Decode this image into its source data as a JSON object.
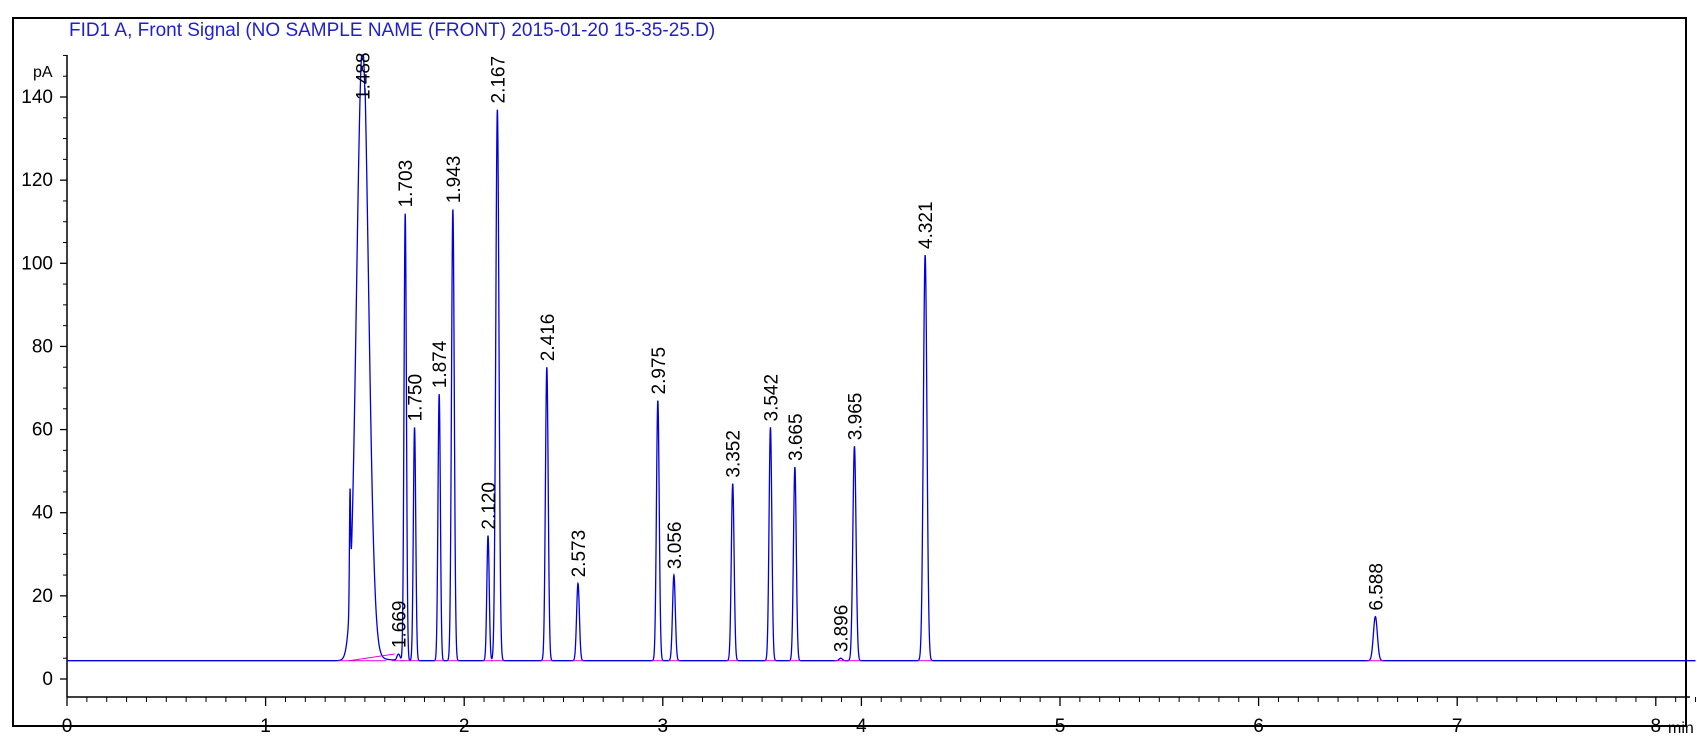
{
  "chart_data": {
    "type": "line",
    "title": "FID1 A, Front Signal (NO SAMPLE NAME (FRONT) 2015-01-20 15-35-25.D)",
    "ylabel": "pA",
    "xlabel": "min",
    "xlim": [
      0,
      8.2
    ],
    "ylim": [
      -3,
      150
    ],
    "x_ticks": [
      0,
      1,
      2,
      3,
      4,
      5,
      6,
      7,
      8
    ],
    "y_ticks": [
      0,
      20,
      40,
      60,
      80,
      100,
      120,
      140
    ],
    "baseline": 4.4,
    "colors": {
      "signal": "#0000e0",
      "baseline_marker": "#e000e0",
      "title": "#1f1fd0"
    },
    "peaks": [
      {
        "rt": 1.488,
        "label": "1.488",
        "height": 152,
        "width": 0.03
      },
      {
        "rt": 1.669,
        "label": "1.669",
        "height": 6.0,
        "width": 0.008
      },
      {
        "rt": 1.703,
        "label": "1.703",
        "height": 112,
        "width": 0.006
      },
      {
        "rt": 1.75,
        "label": "1.750",
        "height": 60.5,
        "width": 0.006
      },
      {
        "rt": 1.874,
        "label": "1.874",
        "height": 68.5,
        "width": 0.006
      },
      {
        "rt": 1.943,
        "label": "1.943",
        "height": 113,
        "width": 0.007
      },
      {
        "rt": 2.12,
        "label": "2.120",
        "height": 34.5,
        "width": 0.006
      },
      {
        "rt": 2.167,
        "label": "2.167",
        "height": 137,
        "width": 0.008
      },
      {
        "rt": 2.416,
        "label": "2.416",
        "height": 75,
        "width": 0.007
      },
      {
        "rt": 2.573,
        "label": "2.573",
        "height": 23,
        "width": 0.007
      },
      {
        "rt": 2.975,
        "label": "2.975",
        "height": 67,
        "width": 0.007
      },
      {
        "rt": 3.056,
        "label": "3.056",
        "height": 25,
        "width": 0.007
      },
      {
        "rt": 3.352,
        "label": "3.352",
        "height": 47,
        "width": 0.007
      },
      {
        "rt": 3.542,
        "label": "3.542",
        "height": 60.5,
        "width": 0.007
      },
      {
        "rt": 3.665,
        "label": "3.665",
        "height": 51,
        "width": 0.007
      },
      {
        "rt": 3.896,
        "label": "3.896",
        "height": 5.0,
        "width": 0.008
      },
      {
        "rt": 3.965,
        "label": "3.965",
        "height": 56,
        "width": 0.008
      },
      {
        "rt": 4.321,
        "label": "4.321",
        "height": 102,
        "width": 0.009
      },
      {
        "rt": 6.588,
        "label": "6.588",
        "height": 15,
        "width": 0.01
      }
    ]
  }
}
